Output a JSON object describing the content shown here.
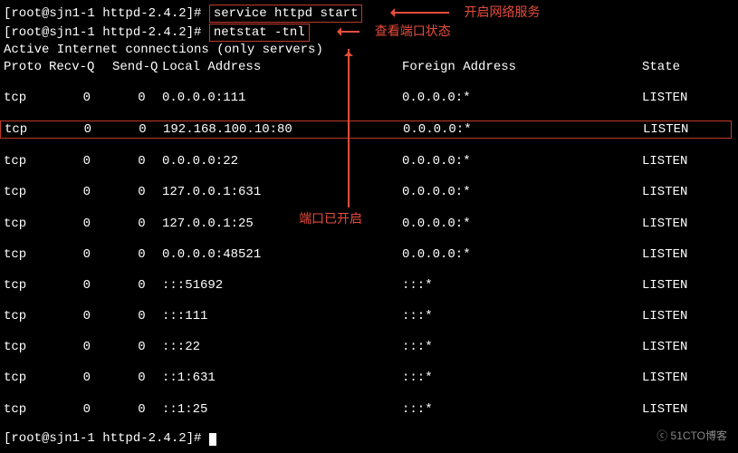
{
  "prompt1": {
    "prefix": "[root@sjn1-1 httpd-2.4.2]# ",
    "cmd": "service httpd start",
    "annot": "开启网络服务"
  },
  "prompt2": {
    "prefix": "[root@sjn1-1 httpd-2.4.2]# ",
    "cmd": "netstat -tnl",
    "annot": "查看端口状态"
  },
  "banner": "Active Internet connections (only servers)",
  "headers": {
    "proto": "Proto ",
    "recvq": "Recv-Q ",
    "sendq": "Send-Q ",
    "local": "Local Address",
    "foreign": "Foreign Address",
    "state": "State"
  },
  "rows": [
    {
      "proto": "tcp",
      "recvq": "0",
      "sendq": "0",
      "local": "0.0.0.0:111",
      "foreign": "0.0.0.0:*",
      "state": "LISTEN",
      "hl": false
    },
    {
      "proto": "tcp",
      "recvq": "0",
      "sendq": "0",
      "local": "192.168.100.10:80",
      "foreign": "0.0.0.0:*",
      "state": "LISTEN",
      "hl": true
    },
    {
      "proto": "tcp",
      "recvq": "0",
      "sendq": "0",
      "local": "0.0.0.0:22",
      "foreign": "0.0.0.0:*",
      "state": "LISTEN",
      "hl": false
    },
    {
      "proto": "tcp",
      "recvq": "0",
      "sendq": "0",
      "local": "127.0.0.1:631",
      "foreign": "0.0.0.0:*",
      "state": "LISTEN",
      "hl": false
    },
    {
      "proto": "tcp",
      "recvq": "0",
      "sendq": "0",
      "local": "127.0.0.1:25",
      "foreign": "0.0.0.0:*",
      "state": "LISTEN",
      "hl": false
    },
    {
      "proto": "tcp",
      "recvq": "0",
      "sendq": "0",
      "local": "0.0.0.0:48521",
      "foreign": "0.0.0.0:*",
      "state": "LISTEN",
      "hl": false
    },
    {
      "proto": "tcp",
      "recvq": "0",
      "sendq": "0",
      "local": ":::51692",
      "foreign": ":::*",
      "state": "LISTEN",
      "hl": false
    },
    {
      "proto": "tcp",
      "recvq": "0",
      "sendq": "0",
      "local": ":::111",
      "foreign": ":::*",
      "state": "LISTEN",
      "hl": false
    },
    {
      "proto": "tcp",
      "recvq": "0",
      "sendq": "0",
      "local": ":::22",
      "foreign": ":::*",
      "state": "LISTEN",
      "hl": false
    },
    {
      "proto": "tcp",
      "recvq": "0",
      "sendq": "0",
      "local": "::1:631",
      "foreign": ":::*",
      "state": "LISTEN",
      "hl": false
    },
    {
      "proto": "tcp",
      "recvq": "0",
      "sendq": "0",
      "local": "::1:25",
      "foreign": ":::*",
      "state": "LISTEN",
      "hl": false
    }
  ],
  "prompt3": {
    "prefix": "[root@sjn1-1 httpd-2.4.2]# "
  },
  "center_annot": "端口已开启",
  "watermark": "ⓒ 51CTO博客"
}
